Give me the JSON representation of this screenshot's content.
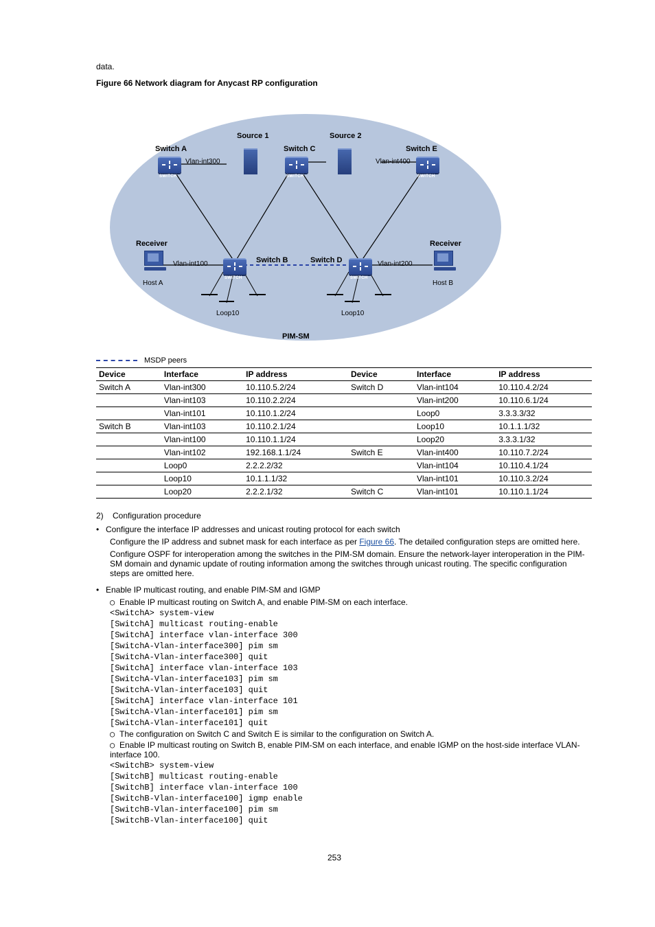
{
  "intro": "data.",
  "figure_title": "Figure 66 Network diagram for Anycast RP configuration",
  "diagram": {
    "source1": "Source 1",
    "source2": "Source 2",
    "switchA": "Switch A",
    "switchB": "Switch B",
    "switchC": "Switch C",
    "switchD": "Switch D",
    "switchE": "Switch E",
    "receiver_l": "Receiver",
    "receiver_r": "Receiver",
    "hostA": "Host A",
    "hostB": "Host B",
    "vlan300": "Vlan-int300",
    "vlan400": "Vlan-int400",
    "vlan100": "Vlan-int100",
    "vlan200": "Vlan-int200",
    "loop_b": "Loop10",
    "loop_d": "Loop10",
    "pimsm": "PIM-SM",
    "legend": "MSDP peers"
  },
  "table": {
    "headers": [
      "Device",
      "Interface",
      "IP address",
      "Device",
      "Interface",
      "IP address"
    ],
    "rows": [
      [
        "Switch A",
        "Vlan-int300",
        "10.110.5.2/24",
        "Switch D",
        "Vlan-int104",
        "10.110.4.2/24"
      ],
      [
        "",
        "Vlan-int103",
        "10.110.2.2/24",
        "",
        "Vlan-int200",
        "10.110.6.1/24"
      ],
      [
        "",
        "Vlan-int101",
        "10.110.1.2/24",
        "",
        "Loop0",
        "3.3.3.3/32"
      ],
      [
        "Switch B",
        "Vlan-int103",
        "10.110.2.1/24",
        "",
        "Loop10",
        "10.1.1.1/32"
      ],
      [
        "",
        "Vlan-int100",
        "10.110.1.1/24",
        "",
        "Loop20",
        "3.3.3.1/32"
      ],
      [
        "",
        "Vlan-int102",
        "192.168.1.1/24",
        "Switch E",
        "Vlan-int400",
        "10.110.7.2/24"
      ],
      [
        "",
        "Loop0",
        "2.2.2.2/32",
        "",
        "Vlan-int104",
        "10.110.4.1/24"
      ],
      [
        "",
        "Loop10",
        "10.1.1.1/32",
        "",
        "Vlan-int101",
        "10.110.3.2/24"
      ],
      [
        "",
        "Loop20",
        "2.2.2.1/32",
        "Switch C",
        "Vlan-int101",
        "10.110.1.1/24"
      ]
    ]
  },
  "steps": {
    "step1": "Configure the interface IP addresses and unicast routing protocol for each switch",
    "step1_text": "Configure the IP address and subnet mask for each interface as per ",
    "figref": "Figure 66",
    "step1_tail": ". The detailed configuration steps are omitted here.",
    "step1_note": "Configure OSPF for interoperation among the switches in the PIM-SM domain. Ensure the network-layer interoperation in the PIM-SM domain and dynamic update of routing information among the switches through unicast routing. The specific configuration steps are omitted here.",
    "step2": "Enable IP multicast routing, and enable PIM-SM and IGMP",
    "sub2a": "Enable IP multicast routing on Switch A, and enable PIM-SM on each interface.",
    "cmd_block1": [
      "<SwitchA> system-view",
      "[SwitchA] multicast routing-enable",
      "[SwitchA] interface vlan-interface 300",
      "[SwitchA-Vlan-interface300] pim sm",
      "[SwitchA-Vlan-interface300] quit",
      "[SwitchA] interface vlan-interface 103",
      "[SwitchA-Vlan-interface103] pim sm",
      "[SwitchA-Vlan-interface103] quit",
      "[SwitchA] interface vlan-interface 101",
      "[SwitchA-Vlan-interface101] pim sm",
      "[SwitchA-Vlan-interface101] quit"
    ],
    "sub2b": "The configuration on Switch C and Switch E is similar to the configuration on Switch A.",
    "sub2c": "Enable IP multicast routing on Switch B, enable PIM-SM on each interface, and enable IGMP on the host-side interface VLAN-interface 100.",
    "cmd_block2": [
      "<SwitchB> system-view",
      "[SwitchB] multicast routing-enable",
      "[SwitchB] interface vlan-interface 100",
      "[SwitchB-Vlan-interface100] igmp enable",
      "[SwitchB-Vlan-interface100] pim sm",
      "[SwitchB-Vlan-interface100] quit"
    ]
  },
  "page_num": "253"
}
